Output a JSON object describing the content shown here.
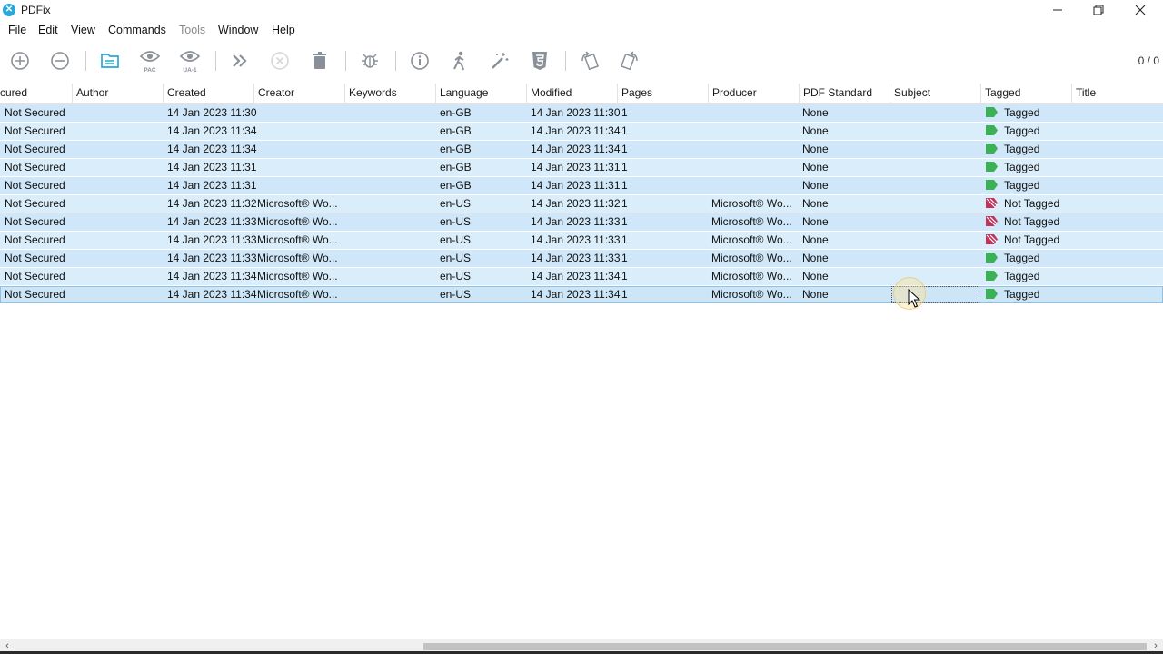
{
  "window": {
    "title": "PDFix",
    "app_icon_glyph": "✕",
    "controls": [
      "minimize-icon",
      "restore-icon",
      "close-icon"
    ]
  },
  "menu": {
    "items": [
      {
        "label": "File",
        "enabled": true
      },
      {
        "label": "Edit",
        "enabled": true
      },
      {
        "label": "View",
        "enabled": true
      },
      {
        "label": "Commands",
        "enabled": true
      },
      {
        "label": "Tools",
        "enabled": false
      },
      {
        "label": "Window",
        "enabled": true
      },
      {
        "label": "Help",
        "enabled": true
      }
    ]
  },
  "toolbar": {
    "buttons": [
      {
        "icon": "add-circle-icon",
        "enabled": true
      },
      {
        "icon": "remove-circle-icon",
        "enabled": true
      },
      {
        "icon": "open-folder-icon",
        "enabled": true
      },
      {
        "icon": "eye-pac-icon",
        "enabled": true,
        "sub": "PAC"
      },
      {
        "icon": "eye-ua1-icon",
        "enabled": true,
        "sub": "UA-1"
      },
      {
        "icon": "fast-forward-icon",
        "enabled": true
      },
      {
        "icon": "stop-circle-icon",
        "enabled": false
      },
      {
        "icon": "trash-icon",
        "enabled": true
      },
      {
        "icon": "bug-icon",
        "enabled": true
      },
      {
        "icon": "info-icon",
        "enabled": true
      },
      {
        "icon": "accessibility-person-icon",
        "enabled": true
      },
      {
        "icon": "magic-wand-icon",
        "enabled": true
      },
      {
        "icon": "html5-icon",
        "enabled": true
      },
      {
        "icon": "rotate-left-icon",
        "enabled": true
      },
      {
        "icon": "rotate-right-icon",
        "enabled": true
      }
    ],
    "page_counter": "0 / 0"
  },
  "table": {
    "columns": [
      "cured",
      "Author",
      "Created",
      "Creator",
      "Keywords",
      "Language",
      "Modified",
      "Pages",
      "Producer",
      "PDF Standard",
      "Subject",
      "Tagged",
      "Title"
    ],
    "rows": [
      {
        "secured": "Not Secured",
        "author": "",
        "created": "14 Jan 2023 11:30",
        "creator": "",
        "keywords": "",
        "language": "en-GB",
        "modified": "14 Jan 2023 11:30",
        "pages": "1",
        "producer": "",
        "standard": "None",
        "subject": "",
        "tagged": "Tagged",
        "title": ""
      },
      {
        "secured": "Not Secured",
        "author": "",
        "created": "14 Jan 2023 11:34",
        "creator": "",
        "keywords": "",
        "language": "en-GB",
        "modified": "14 Jan 2023 11:34",
        "pages": "1",
        "producer": "",
        "standard": "None",
        "subject": "",
        "tagged": "Tagged",
        "title": ""
      },
      {
        "secured": "Not Secured",
        "author": "",
        "created": "14 Jan 2023 11:34",
        "creator": "",
        "keywords": "",
        "language": "en-GB",
        "modified": "14 Jan 2023 11:34",
        "pages": "1",
        "producer": "",
        "standard": "None",
        "subject": "",
        "tagged": "Tagged",
        "title": ""
      },
      {
        "secured": "Not Secured",
        "author": "",
        "created": "14 Jan 2023 11:31",
        "creator": "",
        "keywords": "",
        "language": "en-GB",
        "modified": "14 Jan 2023 11:31",
        "pages": "1",
        "producer": "",
        "standard": "None",
        "subject": "",
        "tagged": "Tagged",
        "title": ""
      },
      {
        "secured": "Not Secured",
        "author": "",
        "created": "14 Jan 2023 11:31",
        "creator": "",
        "keywords": "",
        "language": "en-GB",
        "modified": "14 Jan 2023 11:31",
        "pages": "1",
        "producer": "",
        "standard": "None",
        "subject": "",
        "tagged": "Tagged",
        "title": ""
      },
      {
        "secured": "Not Secured",
        "author": "",
        "created": "14 Jan 2023 11:32",
        "creator": "Microsoft® Wo...",
        "keywords": "",
        "language": "en-US",
        "modified": "14 Jan 2023 11:32",
        "pages": "1",
        "producer": "Microsoft® Wo...",
        "standard": "None",
        "subject": "",
        "tagged": "Not Tagged",
        "title": ""
      },
      {
        "secured": "Not Secured",
        "author": "",
        "created": "14 Jan 2023 11:33",
        "creator": "Microsoft® Wo...",
        "keywords": "",
        "language": "en-US",
        "modified": "14 Jan 2023 11:33",
        "pages": "1",
        "producer": "Microsoft® Wo...",
        "standard": "None",
        "subject": "",
        "tagged": "Not Tagged",
        "title": ""
      },
      {
        "secured": "Not Secured",
        "author": "",
        "created": "14 Jan 2023 11:33",
        "creator": "Microsoft® Wo...",
        "keywords": "",
        "language": "en-US",
        "modified": "14 Jan 2023 11:33",
        "pages": "1",
        "producer": "Microsoft® Wo...",
        "standard": "None",
        "subject": "",
        "tagged": "Not Tagged",
        "title": ""
      },
      {
        "secured": "Not Secured",
        "author": "",
        "created": "14 Jan 2023 11:33",
        "creator": "Microsoft® Wo...",
        "keywords": "",
        "language": "en-US",
        "modified": "14 Jan 2023 11:33",
        "pages": "1",
        "producer": "Microsoft® Wo...",
        "standard": "None",
        "subject": "",
        "tagged": "Tagged",
        "title": ""
      },
      {
        "secured": "Not Secured",
        "author": "",
        "created": "14 Jan 2023 11:34",
        "creator": "Microsoft® Wo...",
        "keywords": "",
        "language": "en-US",
        "modified": "14 Jan 2023 11:34",
        "pages": "1",
        "producer": "Microsoft® Wo...",
        "standard": "None",
        "subject": "",
        "tagged": "Tagged",
        "title": ""
      },
      {
        "secured": "Not Secured",
        "author": "",
        "created": "14 Jan 2023 11:34",
        "creator": "Microsoft® Wo...",
        "keywords": "",
        "language": "en-US",
        "modified": "14 Jan 2023 11:34",
        "pages": "1",
        "producer": "Microsoft® Wo...",
        "standard": "None",
        "subject": "",
        "tagged": "Tagged",
        "title": ""
      }
    ]
  },
  "colors": {
    "tagged": "#3cb054",
    "not_tagged": "#c2325a",
    "row_selected": "#cfe7f8",
    "accent": "#2aa7d8"
  }
}
